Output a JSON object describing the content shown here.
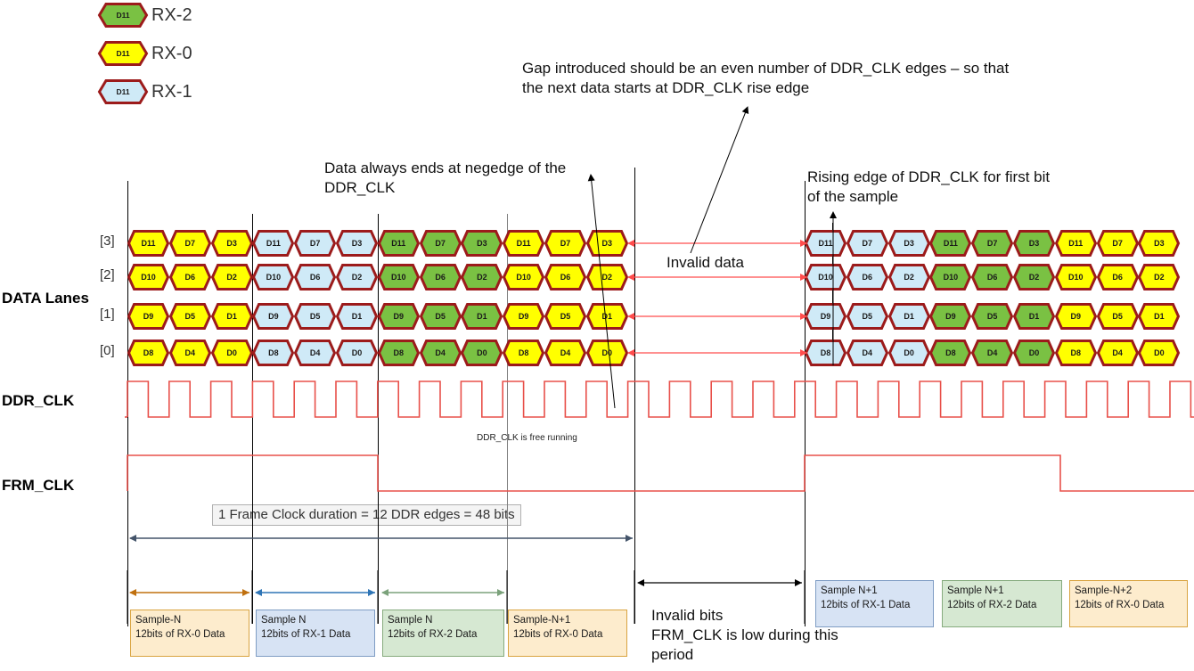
{
  "legend": {
    "items": [
      {
        "label": "RX-2",
        "cell_text": "D11",
        "fill": "#7ac143",
        "name": "legend-rx2"
      },
      {
        "label": "RX-0",
        "cell_text": "D11",
        "fill": "#ffff00",
        "name": "legend-rx0"
      },
      {
        "label": "RX-1",
        "cell_text": "D11",
        "fill": "#cfeaf7",
        "name": "legend-rx1"
      }
    ]
  },
  "colors": {
    "rx0": "#ffff00",
    "rx1": "#cfeaf7",
    "rx2": "#7ac143",
    "hex_stroke": "#9c1b1b",
    "clock": "#e8504a",
    "guide": "#000000",
    "guide_grey": "#808080",
    "frame_arrow": "#44546a",
    "arrow_amber": "#c0700f",
    "arrow_blue": "#2e75b6",
    "arrow_green": "#7ba27b",
    "invalid_arrow": "#ff4d4d"
  },
  "annotations": {
    "gap_note": "Gap introduced should be an even number of DDR_CLK edges – so that the next data starts at DDR_CLK rise edge",
    "negedge_note": "Data always ends at negedge of the DDR_CLK",
    "rising_note": "Rising edge of DDR_CLK for first bit of the sample",
    "invalid_data": "Invalid data",
    "free_running": "DDR_CLK is free running",
    "frame_duration": "1 Frame Clock duration = 12 DDR edges = 48 bits",
    "invalid_bits": "Invalid bits FRM_CLK is low during this period"
  },
  "signals": {
    "data_lanes_label": "DATA Lanes",
    "ddr_clk_label": "DDR_CLK",
    "frm_clk_label": "FRM_CLK",
    "lane_indices": [
      "[3]",
      "[2]",
      "[1]",
      "[0]"
    ]
  },
  "lanes": [
    {
      "index": "[3]",
      "bits": [
        "D11",
        "D7",
        "D3"
      ]
    },
    {
      "index": "[2]",
      "bits": [
        "D10",
        "D6",
        "D2"
      ]
    },
    {
      "index": "[1]",
      "bits": [
        "D9",
        "D5",
        "D1"
      ]
    },
    {
      "index": "[0]",
      "bits": [
        "D8",
        "D4",
        "D0"
      ]
    }
  ],
  "groups_left": [
    {
      "source": "RX-0",
      "fill_key": "rx0"
    },
    {
      "source": "RX-1",
      "fill_key": "rx1"
    },
    {
      "source": "RX-2",
      "fill_key": "rx2"
    },
    {
      "source": "RX-0",
      "fill_key": "rx0"
    }
  ],
  "groups_right": [
    {
      "source": "RX-1",
      "fill_key": "rx1"
    },
    {
      "source": "RX-2",
      "fill_key": "rx2"
    },
    {
      "source": "RX-0",
      "fill_key": "rx0"
    }
  ],
  "sample_boxes_left": [
    {
      "line1": "Sample-N",
      "line2": "12bits of RX-0 Data",
      "style": "amber"
    },
    {
      "line1": "Sample N",
      "line2": "12bits of RX-1 Data",
      "style": "blue"
    },
    {
      "line1": "Sample N",
      "line2": "12bits of RX-2 Data",
      "style": "green"
    },
    {
      "line1": "Sample-N+1",
      "line2": "12bits of RX-0 Data",
      "style": "amber"
    }
  ],
  "sample_boxes_right": [
    {
      "line1": "Sample N+1",
      "line2": "12bits of RX-1 Data",
      "style": "blue"
    },
    {
      "line1": "Sample N+1",
      "line2": "12bits of RX-2 Data",
      "style": "green"
    },
    {
      "line1": "Sample-N+2",
      "line2": "12bits of RX-0 Data",
      "style": "amber"
    }
  ],
  "invalid_bits_lines": [
    "Invalid bits",
    "FRM_CLK is low during this",
    "period"
  ],
  "gap_note_lines": [
    "Gap introduced should be an even number of DDR_CLK edges – so that",
    "the next data starts at DDR_CLK rise edge"
  ],
  "negedge_note_lines": [
    "Data always ends at negedge of the",
    "DDR_CLK"
  ],
  "rising_note_lines": [
    "Rising edge of DDR_CLK for first bit",
    "of the sample"
  ]
}
